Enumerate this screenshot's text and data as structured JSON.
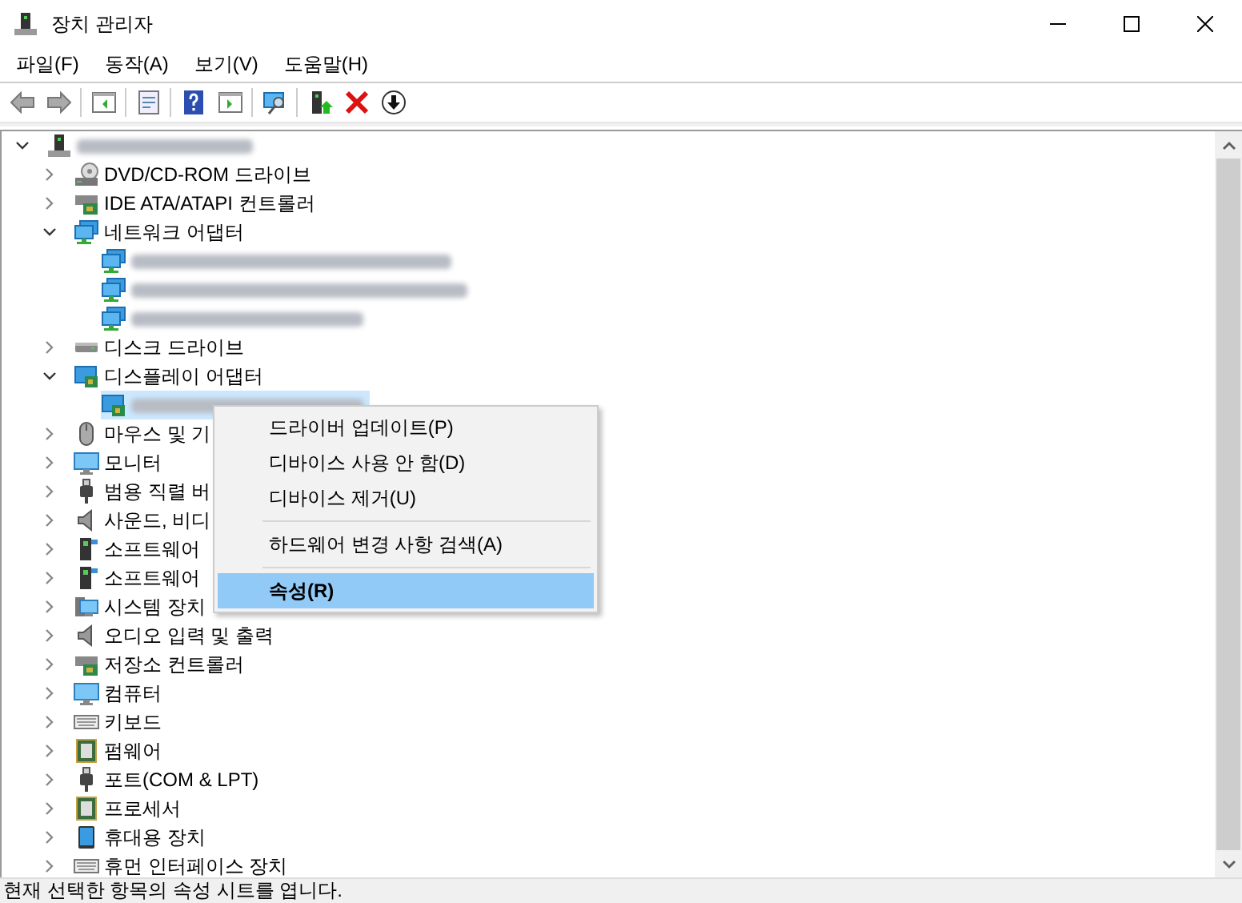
{
  "window": {
    "title": "장치 관리자"
  },
  "menu_bar": [
    "파일(F)",
    "동작(A)",
    "보기(V)",
    "도움말(H)"
  ],
  "tree": [
    {
      "blurred": true,
      "expanded": true,
      "selected": false,
      "children": [
        {
          "label": "DVD/CD-ROM 드라이브",
          "expanded": false,
          "selected": false
        },
        {
          "label": "IDE ATA/ATAPI 컨트롤러",
          "expanded": false,
          "selected": false
        },
        {
          "label": "네트워크 어댑터",
          "expanded": true,
          "selected": false,
          "children": [
            {
              "blurred": true,
              "selected": false
            },
            {
              "blurred": true,
              "selected": false
            },
            {
              "blurred": true,
              "selected": false
            }
          ]
        },
        {
          "label": "디스크 드라이브",
          "expanded": false,
          "selected": false
        },
        {
          "label": "디스플레이 어댑터",
          "expanded": true,
          "selected": false,
          "children": [
            {
              "blurred": true,
              "selected": true
            }
          ]
        },
        {
          "label": "마우스 및 기",
          "expanded": false,
          "selected": false
        },
        {
          "label": "모니터",
          "expanded": false,
          "selected": false
        },
        {
          "label": "범용 직렬 버",
          "expanded": false,
          "selected": false
        },
        {
          "label": "사운드, 비디",
          "expanded": false,
          "selected": false
        },
        {
          "label": "소프트웨어",
          "expanded": false,
          "selected": false
        },
        {
          "label": "소프트웨어",
          "expanded": false,
          "selected": false
        },
        {
          "label": "시스템 장치",
          "expanded": false,
          "selected": false
        },
        {
          "label": "오디오 입력 및 출력",
          "expanded": false,
          "selected": false
        },
        {
          "label": "저장소 컨트롤러",
          "expanded": false,
          "selected": false
        },
        {
          "label": "컴퓨터",
          "expanded": false,
          "selected": false
        },
        {
          "label": "키보드",
          "expanded": false,
          "selected": false
        },
        {
          "label": "펌웨어",
          "expanded": false,
          "selected": false
        },
        {
          "label": "포트(COM & LPT)",
          "expanded": false,
          "selected": false
        },
        {
          "label": "프로세서",
          "expanded": false,
          "selected": false
        },
        {
          "label": "휴대용 장치",
          "expanded": false,
          "selected": false
        },
        {
          "label": "휴먼 인터페이스 장치",
          "expanded": false,
          "selected": false
        }
      ]
    }
  ],
  "context_menu": [
    {
      "label": "드라이버 업데이트(P)",
      "selected": false,
      "default": false,
      "separator_after": false
    },
    {
      "label": "디바이스 사용 안 함(D)",
      "selected": false,
      "default": false,
      "separator_after": false
    },
    {
      "label": "디바이스 제거(U)",
      "selected": false,
      "default": false,
      "separator_after": true
    },
    {
      "label": "하드웨어 변경 사항 검색(A)",
      "selected": false,
      "default": false,
      "separator_after": true
    },
    {
      "label": "속성(R)",
      "selected": true,
      "default": true,
      "separator_after": false
    }
  ],
  "status_bar": "현재 선택한 항목의 속성 시트를 엽니다."
}
